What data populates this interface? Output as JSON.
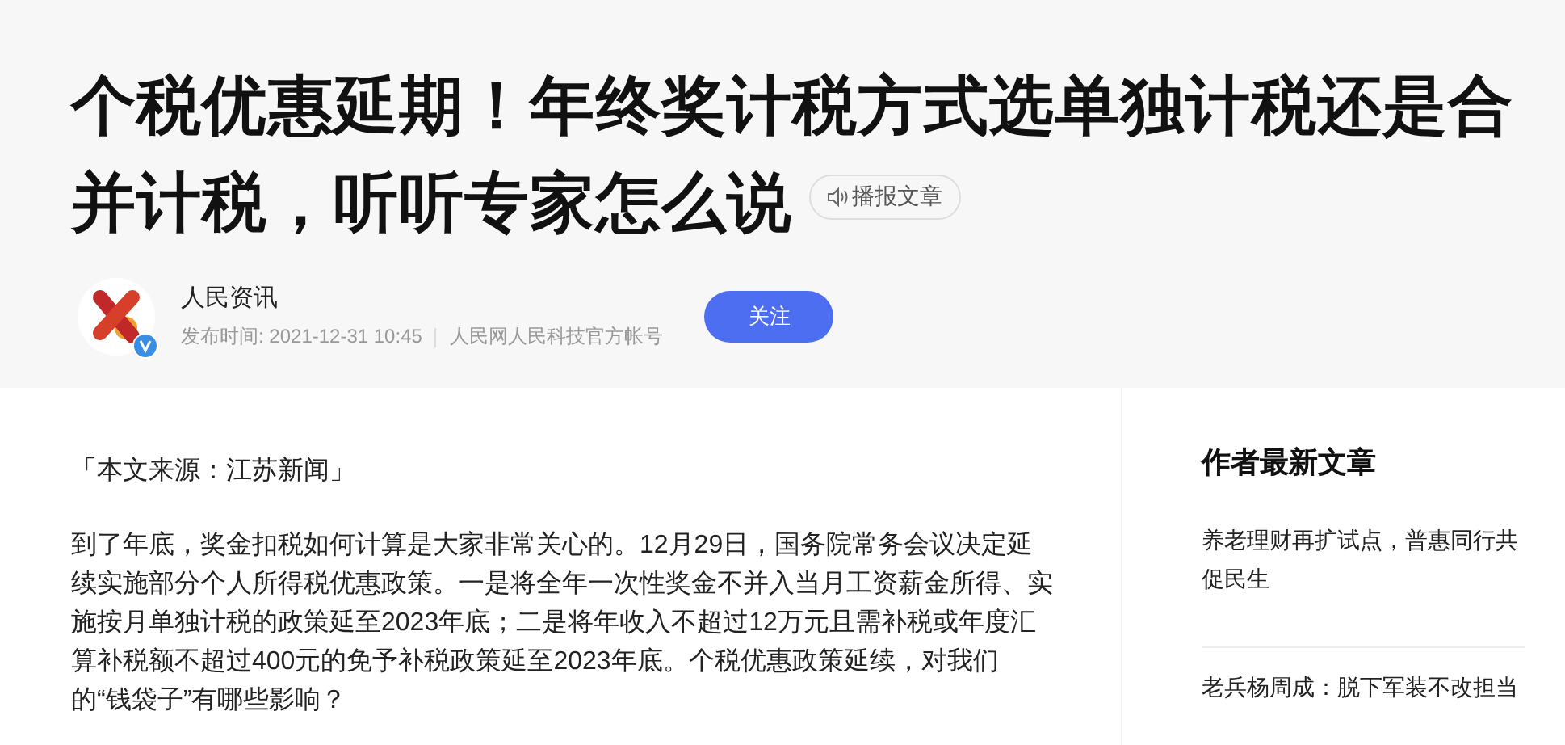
{
  "article": {
    "title": "个税优惠延期！年终奖计税方式选单独计税还是合并计税，听听专家怎么说",
    "listen_button": "播报文章"
  },
  "author": {
    "name": "人民资讯",
    "verified": true,
    "publish_time": "发布时间: 2021-12-31 10:45",
    "account": "人民网人民科技官方帐号",
    "follow_button": "关注"
  },
  "body": {
    "source": "「本文来源：江苏新闻」",
    "paragraphs": [
      "到了年底，奖金扣税如何计算是大家非常关心的。12月29日，国务院常务会议决定延续实施部分个人所得税优惠政策。一是将全年一次性奖金不并入当月工资薪金所得、实施按月单独计税的政策延至2023年底；二是将年收入不超过12万元且需补税或年度汇算补税额不超过400元的免予补税政策延至2023年底。个税优惠政策延续，对我们的“钱袋子”有哪些影响？"
    ]
  },
  "sidebar": {
    "heading": "作者最新文章",
    "items": [
      "养老理财再扩试点，普惠同行共促民生",
      "老兵杨周成：脱下军装不改担当"
    ]
  }
}
